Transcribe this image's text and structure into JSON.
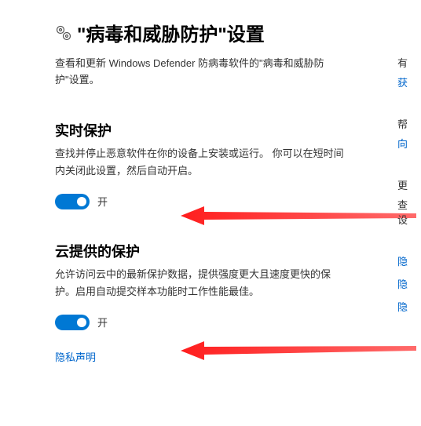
{
  "header": {
    "title": "\"病毒和威胁防护\"设置",
    "summary": "查看和更新 Windows Defender 防病毒软件的\"病毒和威胁防护\"设置。"
  },
  "sections": {
    "realtime": {
      "title": "实时保护",
      "desc": "查找并停止恶意软件在你的设备上安装或运行。 你可以在短时间内关闭此设置，然后自动开启。",
      "state_label": "开"
    },
    "cloud": {
      "title": "云提供的保护",
      "desc": "允许访问云中的最新保护数据，提供强度更大且速度更快的保护。启用自动提交样本功能时工作性能最佳。",
      "state_label": "开"
    }
  },
  "privacy_link": "隐私声明",
  "right": {
    "b1": {
      "l1": "有",
      "l2": "获"
    },
    "b2": {
      "l1": "帮",
      "l2": "向"
    },
    "b3": {
      "l1": "更",
      "l2": "查",
      "l3": "设"
    },
    "links": {
      "a": "隐",
      "b": "隐",
      "c": "隐"
    }
  }
}
